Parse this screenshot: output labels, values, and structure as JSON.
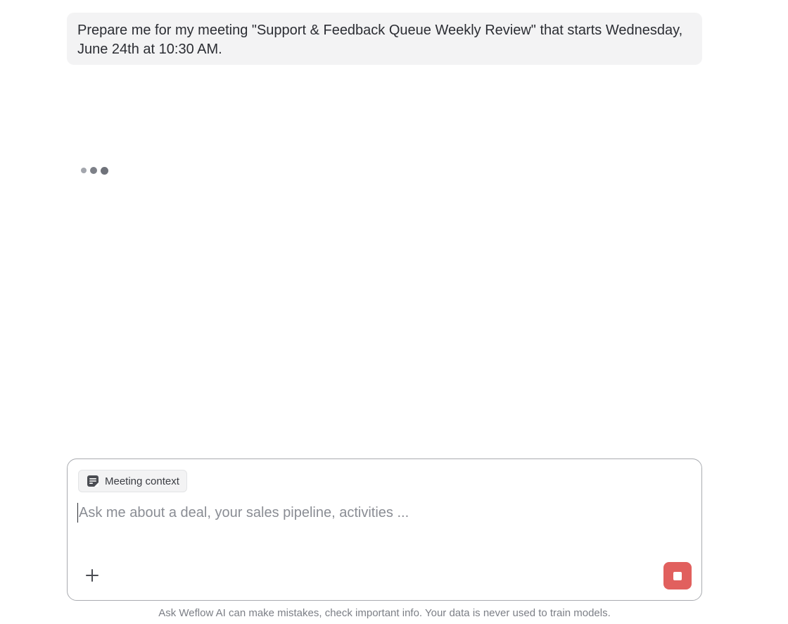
{
  "conversation": {
    "user_message": "Prepare me for my meeting \"Support & Feedback Queue Weekly Review\" that starts Wednesday, June 24th at 10:30 AM.",
    "assistant_status": "typing"
  },
  "composer": {
    "context_chip_label": "Meeting context",
    "context_chip_icon": "document-note-icon",
    "input_placeholder": "Ask me about a deal, your sales pipeline, activities ...",
    "input_value": "",
    "add_icon": "plus-icon",
    "stop_icon": "stop-square-icon",
    "stop_button_color": "#e1605e"
  },
  "footer": {
    "disclaimer": "Ask Weflow AI can make mistakes, check important info. Your data is never used to train models."
  }
}
